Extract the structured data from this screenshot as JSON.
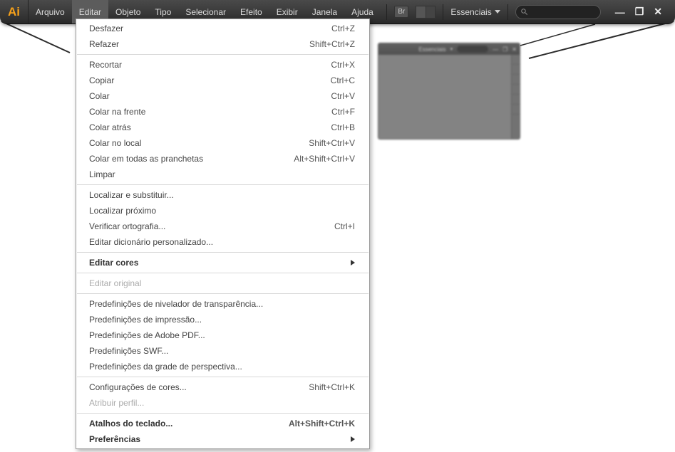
{
  "app_icon_text": "Ai",
  "menus": [
    "Arquivo",
    "Editar",
    "Objeto",
    "Tipo",
    "Selecionar",
    "Efeito",
    "Exibir",
    "Janela",
    "Ajuda"
  ],
  "active_menu_index": 1,
  "toolbar": {
    "bridge_badge": "Br",
    "workspace_label": "Essenciais",
    "search_placeholder": ""
  },
  "window_controls": {
    "minimize": "—",
    "maximize": "❐",
    "close": "✕"
  },
  "mini_window": {
    "workspace_label": "Essenciais"
  },
  "dropdown": [
    {
      "t": "item",
      "label": "Desfazer",
      "shortcut": "Ctrl+Z"
    },
    {
      "t": "item",
      "label": "Refazer",
      "shortcut": "Shift+Ctrl+Z"
    },
    {
      "t": "sep"
    },
    {
      "t": "item",
      "label": "Recortar",
      "shortcut": "Ctrl+X"
    },
    {
      "t": "item",
      "label": "Copiar",
      "shortcut": "Ctrl+C"
    },
    {
      "t": "item",
      "label": "Colar",
      "shortcut": "Ctrl+V"
    },
    {
      "t": "item",
      "label": "Colar na frente",
      "shortcut": "Ctrl+F"
    },
    {
      "t": "item",
      "label": "Colar atrás",
      "shortcut": "Ctrl+B"
    },
    {
      "t": "item",
      "label": "Colar no local",
      "shortcut": "Shift+Ctrl+V"
    },
    {
      "t": "item",
      "label": "Colar em todas as pranchetas",
      "shortcut": "Alt+Shift+Ctrl+V"
    },
    {
      "t": "item",
      "label": "Limpar",
      "shortcut": ""
    },
    {
      "t": "sep"
    },
    {
      "t": "item",
      "label": "Localizar e substituir...",
      "shortcut": ""
    },
    {
      "t": "item",
      "label": "Localizar próximo",
      "shortcut": ""
    },
    {
      "t": "item",
      "label": "Verificar ortografia...",
      "shortcut": "Ctrl+I"
    },
    {
      "t": "item",
      "label": "Editar dicionário personalizado...",
      "shortcut": ""
    },
    {
      "t": "sep"
    },
    {
      "t": "item",
      "label": "Editar cores",
      "sub": true,
      "bold": true
    },
    {
      "t": "sep"
    },
    {
      "t": "item",
      "label": "Editar original",
      "disabled": true
    },
    {
      "t": "sep"
    },
    {
      "t": "item",
      "label": "Predefinições de nivelador de transparência...",
      "shortcut": ""
    },
    {
      "t": "item",
      "label": "Predefinições de impressão...",
      "shortcut": ""
    },
    {
      "t": "item",
      "label": "Predefinições de Adobe PDF...",
      "shortcut": ""
    },
    {
      "t": "item",
      "label": "Predefinições SWF...",
      "shortcut": ""
    },
    {
      "t": "item",
      "label": "Predefinições da grade de perspectiva...",
      "shortcut": ""
    },
    {
      "t": "sep"
    },
    {
      "t": "item",
      "label": "Configurações de cores...",
      "shortcut": "Shift+Ctrl+K"
    },
    {
      "t": "item",
      "label": "Atribuir perfil...",
      "shortcut": "",
      "disabled": true
    },
    {
      "t": "sep"
    },
    {
      "t": "item",
      "label": "Atalhos do teclado...",
      "shortcut": "Alt+Shift+Ctrl+K",
      "bold": true
    },
    {
      "t": "item",
      "label": "Preferências",
      "sub": true,
      "bold": true
    }
  ]
}
